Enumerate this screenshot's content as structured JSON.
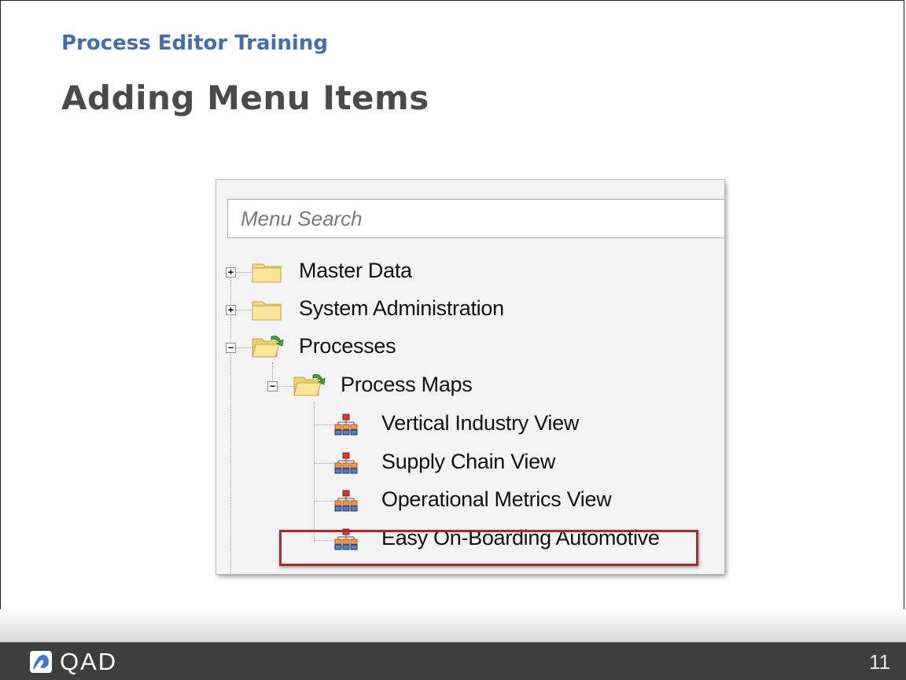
{
  "slide": {
    "course_title": "Process Editor Training",
    "title": "Adding Menu Items",
    "page_number": "11"
  },
  "menu": {
    "search_placeholder": "Menu Search",
    "tree": [
      {
        "label": "Master Data",
        "expander": "+",
        "icon": "folder-closed-icon",
        "level": 0
      },
      {
        "label": "System Administration",
        "expander": "+",
        "icon": "folder-closed-icon",
        "level": 0
      },
      {
        "label": "Processes",
        "expander": "−",
        "icon": "folder-open-icon",
        "level": 0
      },
      {
        "label": "Process Maps",
        "expander": "−",
        "icon": "folder-open-icon",
        "level": 1
      },
      {
        "label": "Vertical Industry View",
        "icon": "process-map-icon",
        "level": 2
      },
      {
        "label": "Supply Chain View",
        "icon": "process-map-icon",
        "level": 2
      },
      {
        "label": "Operational Metrics View",
        "icon": "process-map-icon",
        "level": 2
      },
      {
        "label": "Easy On-Boarding Automotive",
        "icon": "process-map-icon",
        "level": 2,
        "highlighted": true
      }
    ]
  },
  "footer": {
    "logo_text": "QAD"
  },
  "colors": {
    "course_title": "#3f6fb0",
    "title": "#4a4a4a",
    "highlight": "#b52330",
    "footer_bg": "#3e3e3e"
  }
}
